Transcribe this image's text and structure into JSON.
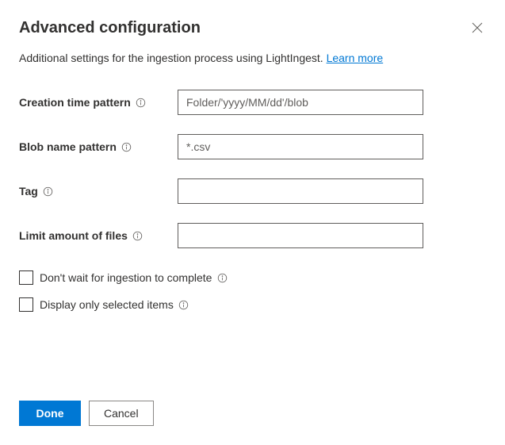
{
  "dialog": {
    "title": "Advanced configuration",
    "subtitle_prefix": "Additional settings for the ingestion process using LightIngest. ",
    "learn_more": "Learn more"
  },
  "fields": {
    "creation_time": {
      "label": "Creation time pattern",
      "placeholder": "Folder/'yyyy/MM/dd'/blob",
      "value": ""
    },
    "blob_name": {
      "label": "Blob name pattern",
      "placeholder": "*.csv",
      "value": ""
    },
    "tag": {
      "label": "Tag",
      "placeholder": "",
      "value": ""
    },
    "limit_files": {
      "label": "Limit amount of files",
      "placeholder": "",
      "value": ""
    }
  },
  "checkboxes": {
    "dont_wait": {
      "label": "Don't wait for ingestion to complete"
    },
    "display_selected": {
      "label": "Display only selected items"
    }
  },
  "footer": {
    "done": "Done",
    "cancel": "Cancel"
  }
}
